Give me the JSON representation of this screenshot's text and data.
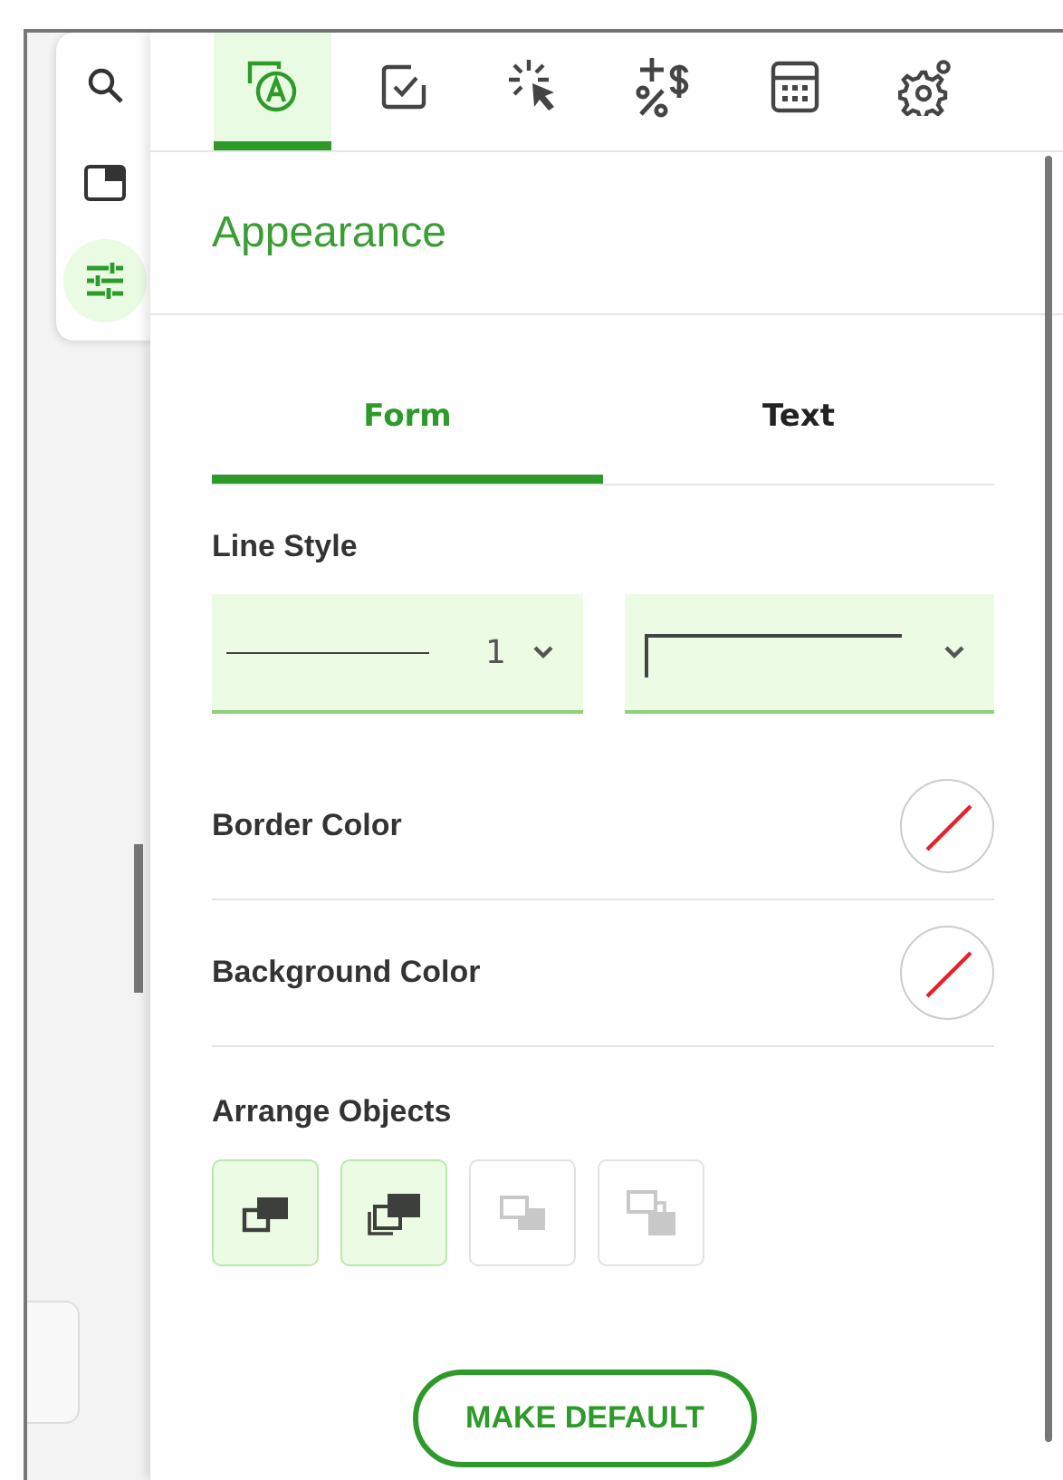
{
  "rail": [
    {
      "kind": "search",
      "selected": false
    },
    {
      "kind": "panel",
      "selected": false
    },
    {
      "kind": "sliders",
      "selected": true
    }
  ],
  "top_tabs": [
    {
      "kind": "appearance",
      "selected": true
    },
    {
      "kind": "checkbox",
      "selected": false
    },
    {
      "kind": "click",
      "selected": false
    },
    {
      "kind": "math",
      "selected": false
    },
    {
      "kind": "calculator",
      "selected": false
    },
    {
      "kind": "settings",
      "selected": false
    }
  ],
  "title": "Appearance",
  "sub_tabs": [
    {
      "label": "Form",
      "selected": true
    },
    {
      "label": "Text",
      "selected": false
    }
  ],
  "line_style": {
    "label": "Line Style",
    "dropdowns": [
      {
        "kind": "width",
        "value": "1"
      },
      {
        "kind": "corner"
      }
    ]
  },
  "color_rows": [
    {
      "label": "Border Color"
    },
    {
      "label": "Background Color"
    }
  ],
  "arrange": {
    "label": "Arrange Objects",
    "buttons": [
      {
        "kind": "front",
        "disabled": false
      },
      {
        "kind": "forward",
        "disabled": false
      },
      {
        "kind": "backward",
        "disabled": true
      },
      {
        "kind": "back",
        "disabled": true
      }
    ]
  },
  "action_button": "MAKE DEFAULT"
}
